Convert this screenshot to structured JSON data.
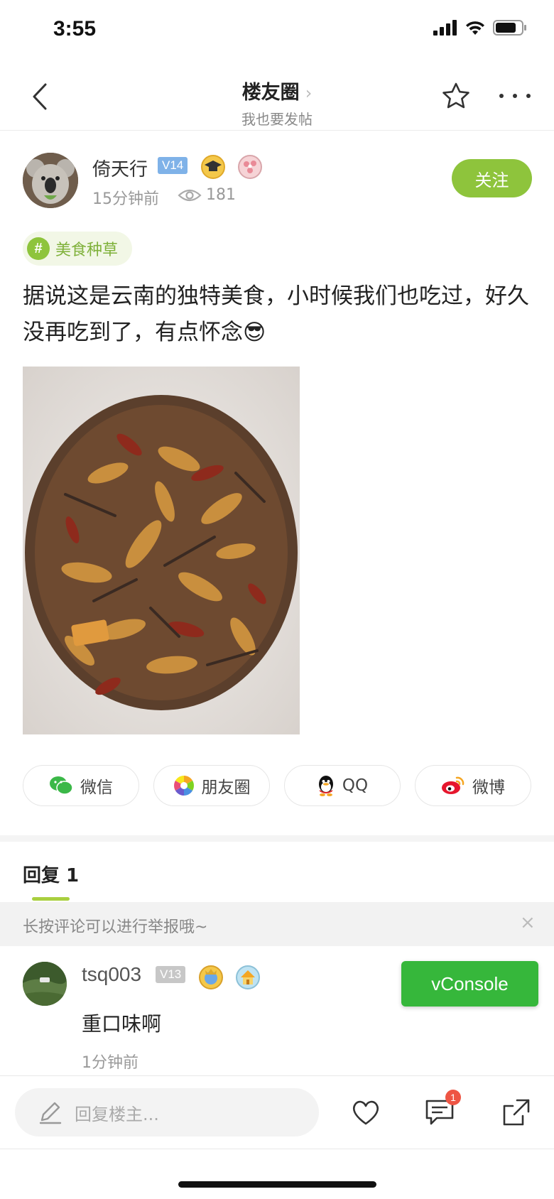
{
  "status_bar": {
    "time": "3:55"
  },
  "nav": {
    "title": "楼友圈",
    "subtitle": "我也要发帖"
  },
  "author": {
    "name": "倚天行",
    "level": "V14",
    "time_ago": "15分钟前",
    "views": "181",
    "follow_label": "关注"
  },
  "topic": {
    "hash": "#",
    "label": "美食种草"
  },
  "post": {
    "text": "据说这是云南的独特美食，小时候我们也吃过，好久没再吃到了，有点怀念😎"
  },
  "share": {
    "wechat": "微信",
    "moments": "朋友圈",
    "qq": "QQ",
    "weibo": "微博"
  },
  "replies": {
    "title": "回复 1",
    "notice": "长按评论可以进行举报哦~",
    "close": "×"
  },
  "comment": {
    "user": "tsq003",
    "level": "V13",
    "text": "重口味啊",
    "time_ago": "1分钟前"
  },
  "vconsole": {
    "label": "vConsole"
  },
  "bottom_bar": {
    "placeholder": "回复楼主...",
    "comment_count": "1"
  },
  "colors": {
    "accent": "#8ec43c",
    "vconsole": "#36b73b",
    "badge_blue": "#7fb2e8",
    "notify_red": "#ee5544"
  }
}
